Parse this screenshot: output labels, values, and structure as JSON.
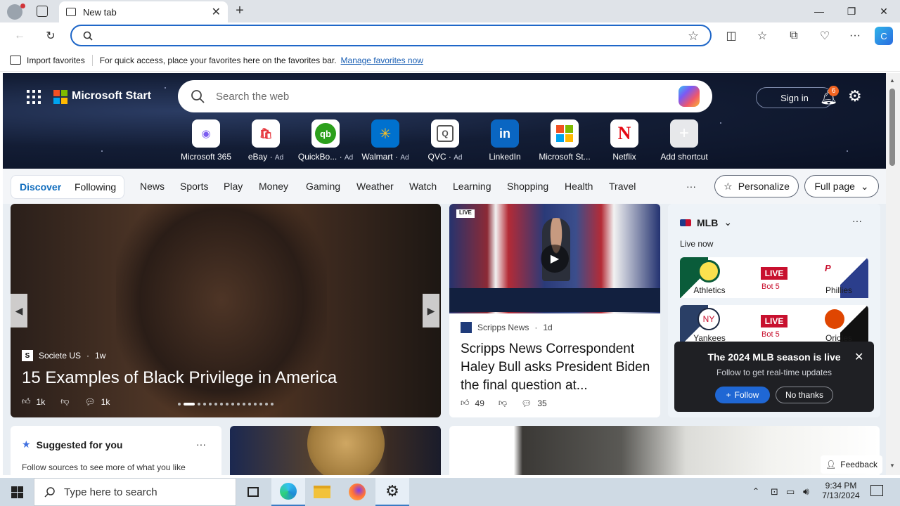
{
  "browser": {
    "tab_title": "New tab",
    "favorites_bar": {
      "import_label": "Import favorites",
      "hint": "For quick access, place your favorites here on the favorites bar.",
      "manage_link": "Manage favorites now"
    }
  },
  "start": {
    "brand": "Microsoft Start",
    "search_placeholder": "Search the web",
    "sign_in": "Sign in",
    "notification_count": "6",
    "shortcuts": [
      {
        "label": "Microsoft 365",
        "ad": ""
      },
      {
        "label": "eBay",
        "ad": "Ad"
      },
      {
        "label": "QuickBo...",
        "ad": "Ad"
      },
      {
        "label": "Walmart",
        "ad": "Ad"
      },
      {
        "label": "QVC",
        "ad": "Ad"
      },
      {
        "label": "LinkedIn",
        "ad": ""
      },
      {
        "label": "Microsoft St...",
        "ad": ""
      },
      {
        "label": "Netflix",
        "ad": ""
      },
      {
        "label": "Add shortcut",
        "ad": ""
      }
    ],
    "nav": {
      "discover": "Discover",
      "following": "Following",
      "items": [
        "News",
        "Sports",
        "Play",
        "Money",
        "Gaming",
        "Weather",
        "Watch",
        "Learning",
        "Shopping",
        "Health",
        "Travel"
      ],
      "more": "···",
      "personalize": "Personalize",
      "full_page": "Full page"
    }
  },
  "feed": {
    "hero": {
      "source": "Societe US",
      "age": "1w",
      "headline": "15 Examples of Black Privilege in America",
      "likes": "1k",
      "comments": "1k"
    },
    "video": {
      "source": "Scripps News",
      "age": "1d",
      "headline": "Scripps News Correspondent Haley Bull asks President Biden the final question at...",
      "likes": "49",
      "comments": "35",
      "badge": "LIVE"
    },
    "mlb": {
      "title": "MLB",
      "live_now": "Live now",
      "games": [
        {
          "home": "Athletics",
          "status": "LIVE",
          "inning": "Bot 5",
          "away": "Phillies"
        },
        {
          "home": "Yankees",
          "status": "LIVE",
          "inning": "Bot 5",
          "away": "Orioles"
        }
      ],
      "popup": {
        "title": "The 2024 MLB season is live",
        "subtitle": "Follow to get real-time updates",
        "follow": "Follow",
        "no_thanks": "No thanks"
      }
    },
    "suggested": {
      "title": "Suggested for you",
      "subtitle": "Follow sources to see more of what you like"
    },
    "feedback": "Feedback"
  },
  "taskbar": {
    "search_placeholder": "Type here to search",
    "time": "9:34 PM",
    "date": "7/13/2024"
  }
}
